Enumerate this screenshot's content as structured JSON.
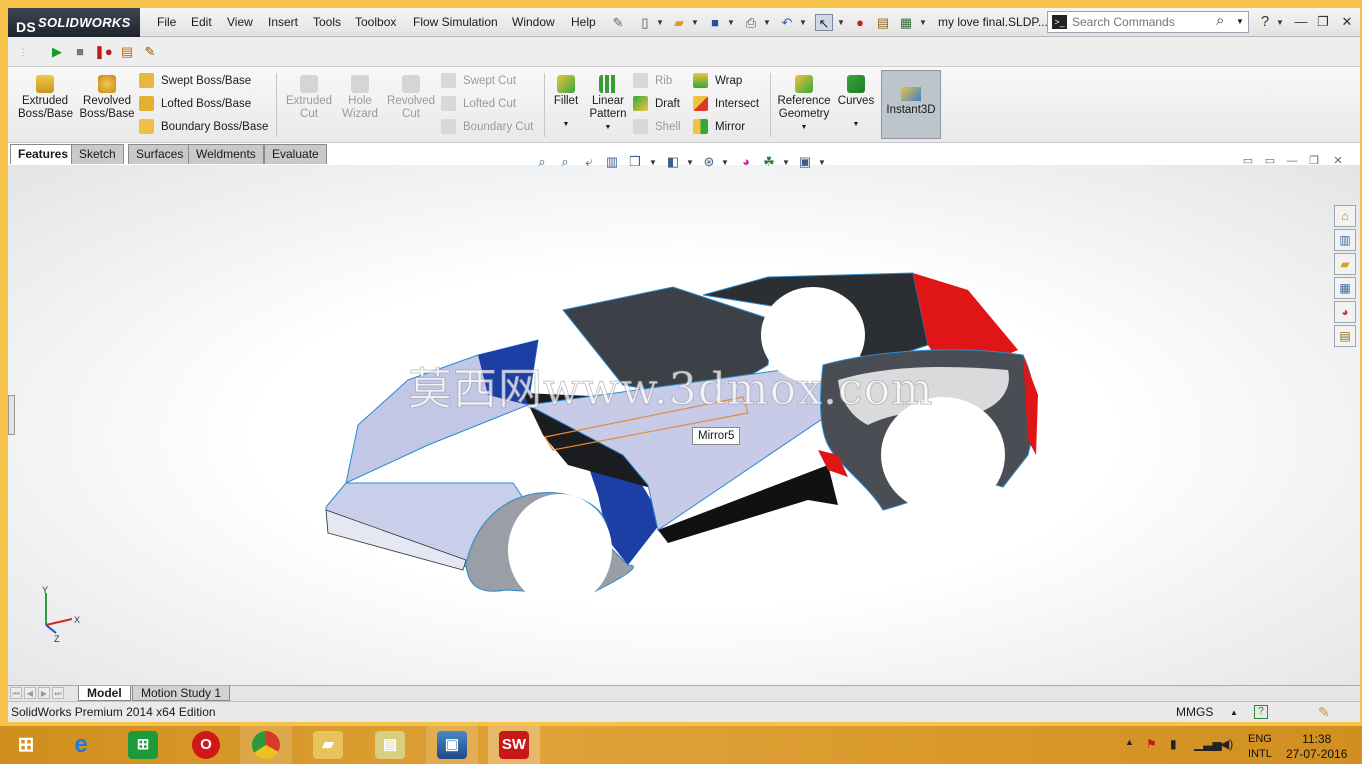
{
  "app": {
    "brand": "SOLIDWORKS",
    "brand_prefix": "DS",
    "document_title": "my love final.SLDP..."
  },
  "menu": [
    "File",
    "Edit",
    "View",
    "Insert",
    "Tools",
    "Toolbox",
    "Flow Simulation",
    "Window",
    "Help"
  ],
  "search": {
    "placeholder": "Search Commands"
  },
  "ribbon": {
    "extruded_boss": "Extruded\nBoss/Base",
    "revolved_boss": "Revolved\nBoss/Base",
    "swept_boss": "Swept Boss/Base",
    "lofted_boss": "Lofted Boss/Base",
    "boundary_boss": "Boundary Boss/Base",
    "extruded_cut": "Extruded\nCut",
    "hole_wizard": "Hole\nWizard",
    "revolved_cut": "Revolved\nCut",
    "swept_cut": "Swept Cut",
    "lofted_cut": "Lofted Cut",
    "boundary_cut": "Boundary Cut",
    "fillet": "Fillet",
    "linear_pattern": "Linear\nPattern",
    "rib": "Rib",
    "draft": "Draft",
    "shell": "Shell",
    "wrap": "Wrap",
    "intersect": "Intersect",
    "mirror": "Mirror",
    "reference_geometry": "Reference\nGeometry",
    "curves": "Curves",
    "instant3d": "Instant3D"
  },
  "tabs": [
    "Features",
    "Sketch",
    "Surfaces",
    "Weldments",
    "Evaluate"
  ],
  "active_tab": "Features",
  "viewport": {
    "watermark": "莫西网www.3dmox.com",
    "tooltip": "Mirror5",
    "triad_x": "X",
    "triad_y": "Y",
    "triad_z": "Z",
    "colors": {
      "blue": "#1c3fa6",
      "red": "#e01616",
      "dark": "#2b2e33",
      "light": "#c9ceea"
    }
  },
  "bottom_tabs": [
    "Model",
    "Motion Study 1"
  ],
  "status": {
    "edition": "SolidWorks Premium 2014 x64 Edition",
    "units": "MMGS"
  },
  "taskbar": {
    "lang_line1": "ENG",
    "lang_line2": "INTL",
    "time": "11:38",
    "date": "27-07-2016"
  }
}
